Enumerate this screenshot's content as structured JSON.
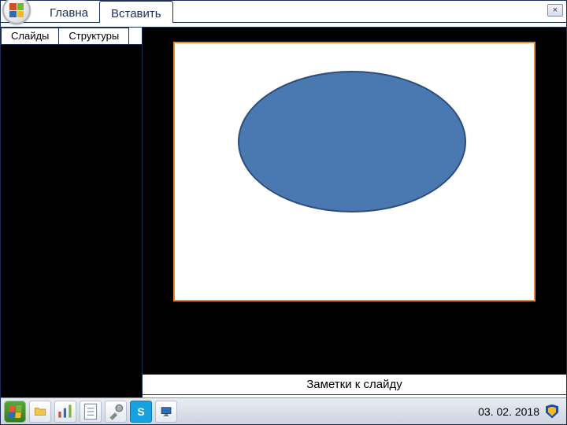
{
  "ribbon": {
    "tabs": [
      {
        "label": "Главна"
      },
      {
        "label": "Вставить"
      }
    ]
  },
  "close_label": "×",
  "left_pane": {
    "tabs": [
      {
        "label": "Слайды"
      },
      {
        "label": "Структуры"
      }
    ]
  },
  "notes_placeholder": "Заметки к слайду",
  "taskbar": {
    "icons": {
      "skype": "S"
    },
    "clock": "03. 02. 2018"
  }
}
